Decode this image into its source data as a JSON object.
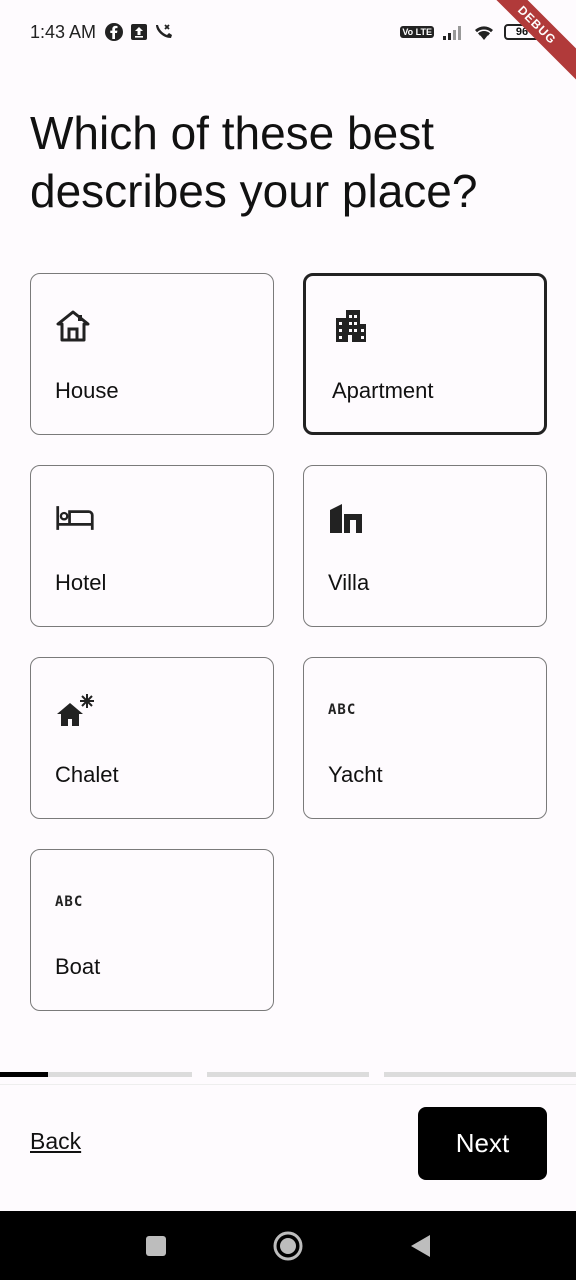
{
  "status_bar": {
    "time": "1:43 AM",
    "battery": "96",
    "volte": "Vo LTE",
    "icons": [
      "facebook-icon",
      "upload-icon",
      "missed-call-icon",
      "signal-icon",
      "wifi-icon",
      "battery-icon"
    ]
  },
  "debug_banner": "DEBUG",
  "title": "Which of these best describes your place?",
  "types": [
    {
      "label": "House",
      "icon": "house-icon",
      "selected": false
    },
    {
      "label": "Apartment",
      "icon": "apartment-icon",
      "selected": true
    },
    {
      "label": "Hotel",
      "icon": "bed-icon",
      "selected": false
    },
    {
      "label": "Villa",
      "icon": "villa-icon",
      "selected": false
    },
    {
      "label": "Chalet",
      "icon": "chalet-icon",
      "selected": false
    },
    {
      "label": "Yacht",
      "icon": "abc-icon",
      "icon_text": "ABC",
      "selected": false
    },
    {
      "label": "Boat",
      "icon": "abc-icon",
      "icon_text": "ABC",
      "selected": false
    }
  ],
  "progress": {
    "step": 1,
    "total_steps": 3,
    "first_step_fill": 0.25
  },
  "footer": {
    "back_label": "Back",
    "next_label": "Next"
  },
  "colors": {
    "primary": "#000000",
    "selected_border": "#222222",
    "background": "#fefbfe",
    "debug": "#b13a3a"
  }
}
